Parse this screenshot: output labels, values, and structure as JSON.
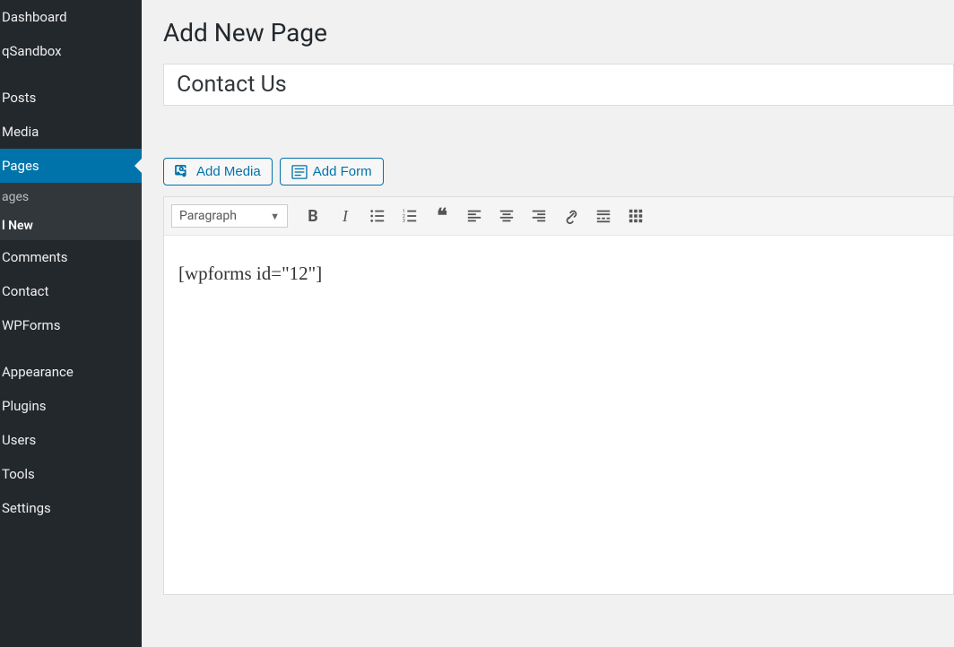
{
  "sidebar": {
    "dashboard": "Dashboard",
    "qsandbox": "qSandbox",
    "posts": "Posts",
    "media": "Media",
    "pages": "Pages",
    "pages_sub": {
      "all": "ages",
      "add_new": "l New"
    },
    "comments": "Comments",
    "contact": "Contact",
    "wpforms": "WPForms",
    "appearance": "Appearance",
    "plugins": "Plugins",
    "users": "Users",
    "tools": "Tools",
    "settings": "Settings"
  },
  "page": {
    "title": "Add New Page",
    "title_input_value": "Contact Us"
  },
  "buttons": {
    "add_media": "Add Media",
    "add_form": "Add Form"
  },
  "format_select": {
    "value": "Paragraph"
  },
  "editor": {
    "content": "[wpforms id=\"12\"]"
  }
}
